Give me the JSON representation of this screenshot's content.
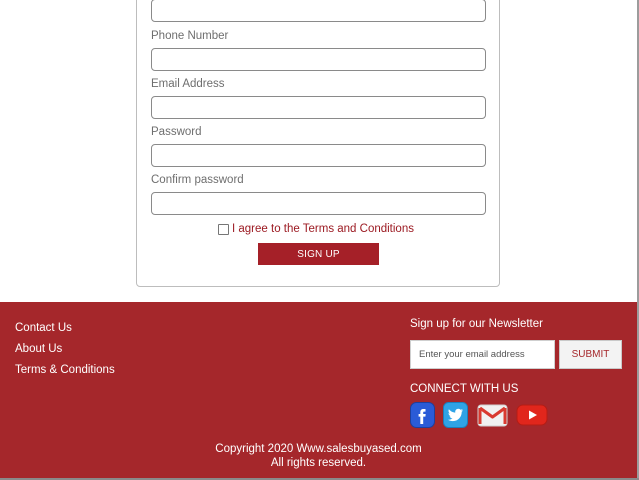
{
  "form": {
    "phone_label": "Phone Number",
    "email_label": "Email Address",
    "password_label": "Password",
    "confirm_label": "Confirm password",
    "agree_text": "I agree to the Terms and Conditions",
    "signup_label": "SIGN UP"
  },
  "footer": {
    "links": [
      "Contact Us",
      "About Us",
      "Terms & Conditions"
    ],
    "newsletter_title": "Sign up for our Newsletter",
    "email_placeholder": "Enter your email address",
    "submit_label": "SUBMIT",
    "connect_title": "CONNECT WITH US",
    "social_icons": [
      "facebook-icon",
      "twitter-icon",
      "gmail-icon",
      "youtube-icon"
    ],
    "copyright_line1": "Copyright 2020 Www.salesbuyased.com",
    "copyright_line2": "All rights reserved."
  },
  "colors": {
    "footer_bg": "#a5272b",
    "button_bg": "#a52028",
    "accent_text": "#9c1a22"
  }
}
